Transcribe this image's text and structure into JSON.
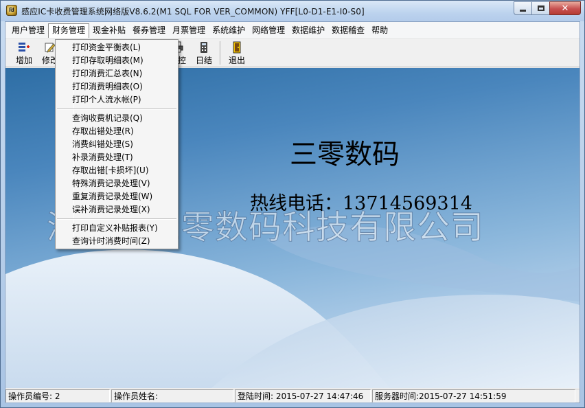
{
  "window": {
    "title": "感应IC卡收费管理系统网络版V8.6.2(M1 SQL FOR VER_COMMON) YFF[L0-D1-E1-I0-S0]",
    "icon": "app-logo-icon"
  },
  "menubar": {
    "items": [
      "用户管理",
      "财务管理",
      "现金补贴",
      "餐券管理",
      "月票管理",
      "系统维护",
      "网络管理",
      "数据维护",
      "数据稽查",
      "帮助"
    ],
    "active": "财务管理"
  },
  "toolbar": {
    "buttons": [
      {
        "label": "增加",
        "icon": "add-user-icon"
      },
      {
        "label": "修改",
        "icon": "edit-icon"
      },
      {
        "label": "监控",
        "icon": "printer-icon"
      },
      {
        "label": "日结",
        "icon": "calculator-icon"
      },
      {
        "label": "退出",
        "icon": "exit-door-icon"
      }
    ]
  },
  "dropdown": {
    "group1": [
      "打印资金平衡表(L)",
      "打印存取明细表(M)",
      "打印消费汇总表(N)",
      "打印消费明细表(O)",
      "打印个人流水帐(P)"
    ],
    "group2": [
      "查询收费机记录(Q)",
      "存取出错处理(R)",
      "消费纠错处理(S)",
      "补录消费处理(T)",
      "存取出错[卡损坏](U)",
      "特殊消费记录处理(V)",
      "重复消费记录处理(W)",
      "误补消费记录处理(X)"
    ],
    "group3": [
      "打印自定义补贴报表(Y)",
      "查询计时消费时间(Z)"
    ]
  },
  "main": {
    "company": "三零数码",
    "hotline": "热线电话：13714569314",
    "watermark": "深圳市三零数码科技有限公司"
  },
  "statusbar": {
    "operator_id": "操作员编号: 2",
    "operator_name": "操作员姓名:",
    "login_time": "登陆时间: 2015-07-27 14:47:46",
    "server_time": "服务器时间:2015-07-27 14:51:59"
  }
}
